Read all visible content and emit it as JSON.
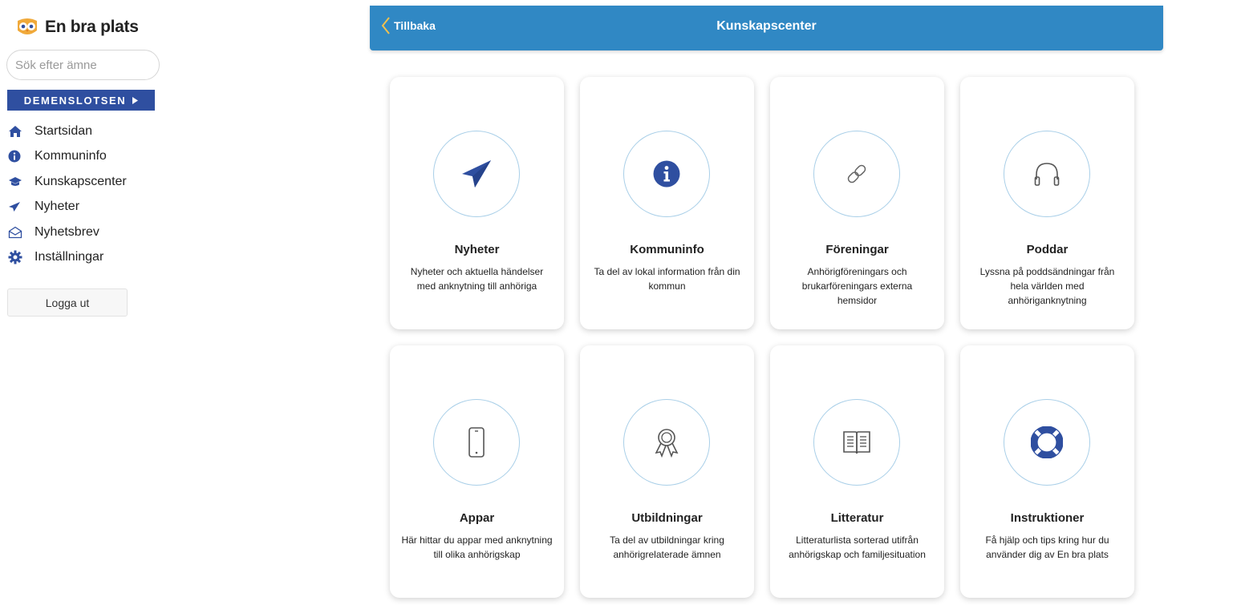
{
  "app": {
    "logo_text": "En bra plats"
  },
  "search": {
    "placeholder": "Sök efter ämne",
    "value": ""
  },
  "sidebar": {
    "demens_button": "DEMENSLOTSEN",
    "items": [
      {
        "label": "Startsidan",
        "icon": "home-icon"
      },
      {
        "label": "Kommuninfo",
        "icon": "info-icon"
      },
      {
        "label": "Kunskapscenter",
        "icon": "graduation-cap-icon"
      },
      {
        "label": "Nyheter",
        "icon": "paper-plane-icon"
      },
      {
        "label": "Nyhetsbrev",
        "icon": "envelope-icon"
      },
      {
        "label": "Inställningar",
        "icon": "gear-icon"
      }
    ],
    "logout": "Logga ut"
  },
  "header": {
    "back": "Tillbaka",
    "title": "Kunskapscenter"
  },
  "colors": {
    "brand_blue": "#2f4fa0",
    "header_blue": "#3088c4",
    "circle_border": "#a9cfe8",
    "back_chevron": "#f2c14e"
  },
  "cards": [
    {
      "title": "Nyheter",
      "desc": "Nyheter och aktuella händelser med anknytning till anhöriga",
      "icon": "paper-plane-icon"
    },
    {
      "title": "Kommuninfo",
      "desc": "Ta del av lokal information från din kommun",
      "icon": "info-icon"
    },
    {
      "title": "Föreningar",
      "desc": "Anhörigföreningars och brukarföreningars externa hemsidor",
      "icon": "link-icon"
    },
    {
      "title": "Poddar",
      "desc": "Lyssna på poddsändningar från hela världen med anhöriganknytning",
      "icon": "headphones-icon"
    },
    {
      "title": "Appar",
      "desc": "Här hittar du appar med anknytning till olika anhörigskap",
      "icon": "phone-icon"
    },
    {
      "title": "Utbildningar",
      "desc": "Ta del av utbildningar kring anhörigrelaterade ämnen",
      "icon": "award-icon"
    },
    {
      "title": "Litteratur",
      "desc": "Litteraturlista sorterad utifrån anhörigskap och familjesituation",
      "icon": "book-icon"
    },
    {
      "title": "Instruktioner",
      "desc": "Få hjälp och tips kring hur du använder dig av En bra plats",
      "icon": "lifebuoy-icon"
    }
  ]
}
